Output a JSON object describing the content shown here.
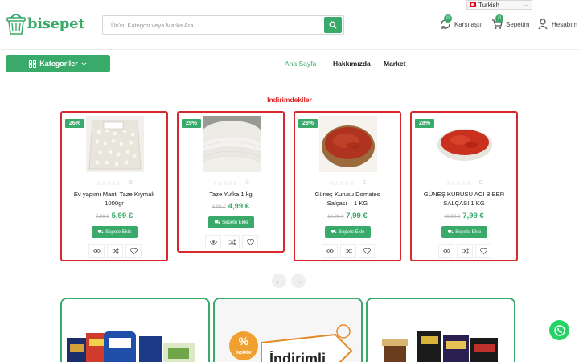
{
  "language": {
    "selected": "Turkish"
  },
  "brand": {
    "name": "bisepet",
    "accent": "#3aaa6a",
    "sale_red": "#d7282f"
  },
  "search": {
    "placeholder": "Ürün, Kategori veya Marka Ara...",
    "icon": "search-icon"
  },
  "header": {
    "compare": {
      "label": "Karşılaştır",
      "count": "0"
    },
    "cart": {
      "label": "Sepetim",
      "count": "0"
    },
    "account": {
      "label": "Hesabım"
    }
  },
  "nav": {
    "categories_label": "Kategoriler",
    "links": [
      "Ana Sayfa",
      "Hakkımızda",
      "Market"
    ]
  },
  "section": {
    "title": "İndirimdekiler"
  },
  "products": [
    {
      "discount": "26%",
      "name_line1": "Ev yapımı Mantı Taze Kıymalı",
      "name_line2": "1000gr",
      "rating_count": "0",
      "old_price": "7,99 €",
      "new_price": "5,99 €",
      "button": "Sepete Ekle"
    },
    {
      "discount": "29%",
      "name_line1": "Taze Yufka 1 kg",
      "name_line2": "",
      "rating_count": "0",
      "old_price": "6,99 €",
      "new_price": "4,99 €",
      "button": "Sepete Ekle"
    },
    {
      "discount": "28%",
      "name_line1": "Güneş Kurusu Domates",
      "name_line2": "Salçası – 1 KG",
      "rating_count": "0",
      "old_price": "10,99 €",
      "new_price": "7,99 €",
      "button": "Sepete Ekle"
    },
    {
      "discount": "28%",
      "name_line1": "GÜNEŞ KURUSU ACI BIBER",
      "name_line2": "SALÇASI 1 KG",
      "rating_count": "0",
      "old_price": "10,99 €",
      "new_price": "7,99 €",
      "button": "Sepete Ekle"
    }
  ],
  "banners": [
    {
      "text": ""
    },
    {
      "badge": "İNDİRİM",
      "text": "İndirimli"
    },
    {
      "text": ""
    }
  ]
}
